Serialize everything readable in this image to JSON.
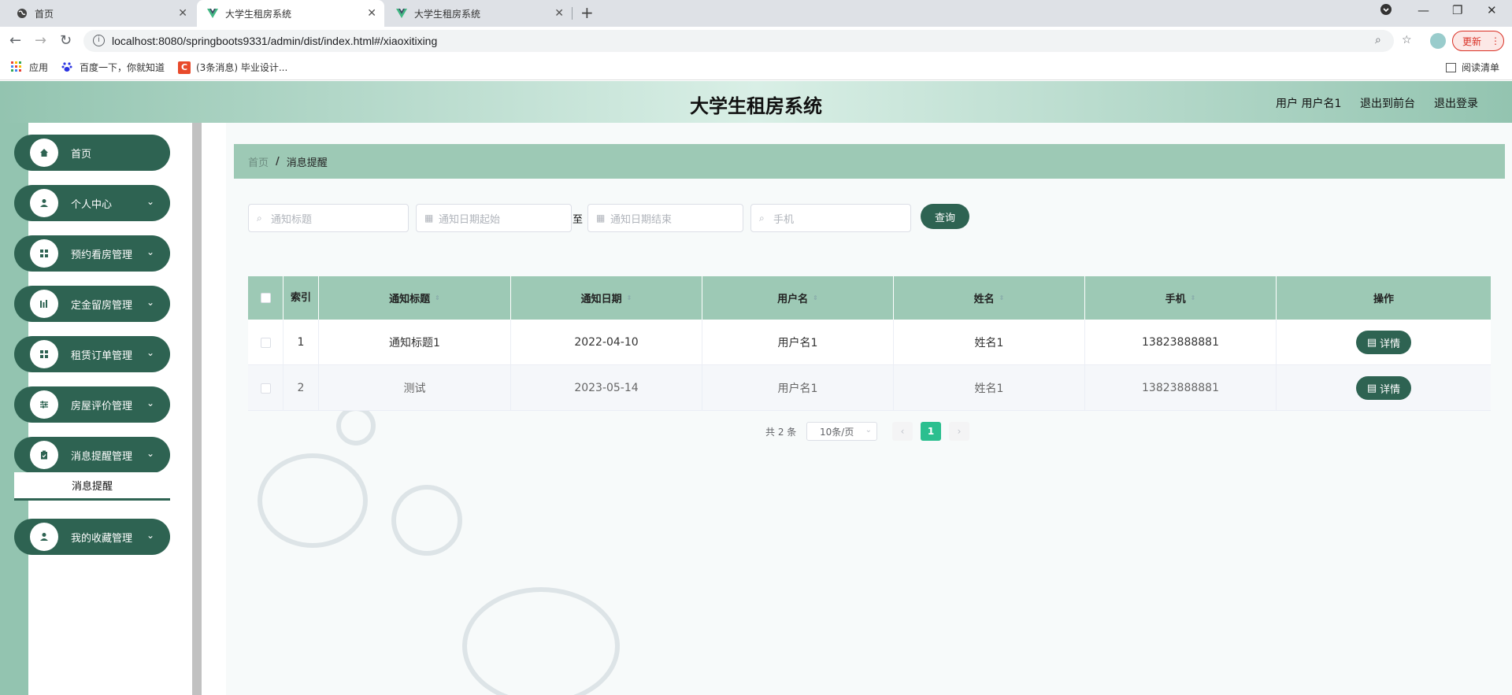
{
  "browser": {
    "tabs": [
      {
        "title": "首页",
        "icon": "globe-icon"
      },
      {
        "title": "大学生租房系统",
        "icon": "vue-icon"
      },
      {
        "title": "大学生租房系统",
        "icon": "vue-icon"
      }
    ],
    "url": "localhost:8080/springboots9331/admin/dist/index.html#/xiaoxitixing",
    "update_label": "更新",
    "bookmarks": [
      "应用",
      "百度一下，你就知道",
      "(3条消息) 毕业设计..."
    ],
    "reading_list": "阅读清单"
  },
  "header": {
    "title": "大学生租房系统",
    "user_label": "用户 用户名1",
    "back_front_label": "退出到前台",
    "logout_label": "退出登录"
  },
  "sidebar": {
    "items": [
      {
        "label": "首页",
        "icon": "home-icon"
      },
      {
        "label": "个人中心",
        "icon": "user-icon"
      },
      {
        "label": "预约看房管理",
        "icon": "grid-icon"
      },
      {
        "label": "定金留房管理",
        "icon": "chart-icon"
      },
      {
        "label": "租赁订单管理",
        "icon": "grid-icon"
      },
      {
        "label": "房屋评价管理",
        "icon": "sliders-icon"
      },
      {
        "label": "消息提醒管理",
        "icon": "clipboard-icon"
      },
      {
        "label": "我的收藏管理",
        "icon": "user-icon"
      }
    ],
    "submenu_active": "消息提醒"
  },
  "breadcrumb": {
    "home": "首页",
    "separator": "/",
    "current": "消息提醒"
  },
  "search": {
    "title_placeholder": "通知标题",
    "date_start_placeholder": "通知日期起始",
    "range_to": "至",
    "date_end_placeholder": "通知日期结束",
    "phone_placeholder": "手机",
    "query_label": "查询"
  },
  "table": {
    "headers": [
      "索引",
      "通知标题",
      "通知日期",
      "用户名",
      "姓名",
      "手机",
      "操作"
    ],
    "rows": [
      {
        "index": "1",
        "title": "通知标题1",
        "date": "2022-04-10",
        "username": "用户名1",
        "name": "姓名1",
        "phone": "13823888881",
        "action": "详情"
      },
      {
        "index": "2",
        "title": "测试",
        "date": "2023-05-14",
        "username": "用户名1",
        "name": "姓名1",
        "phone": "13823888881",
        "action": "详情"
      }
    ]
  },
  "pagination": {
    "total": "共 2 条",
    "page_size": "10条/页",
    "current_page": "1",
    "prev": "‹",
    "next": "›"
  }
}
